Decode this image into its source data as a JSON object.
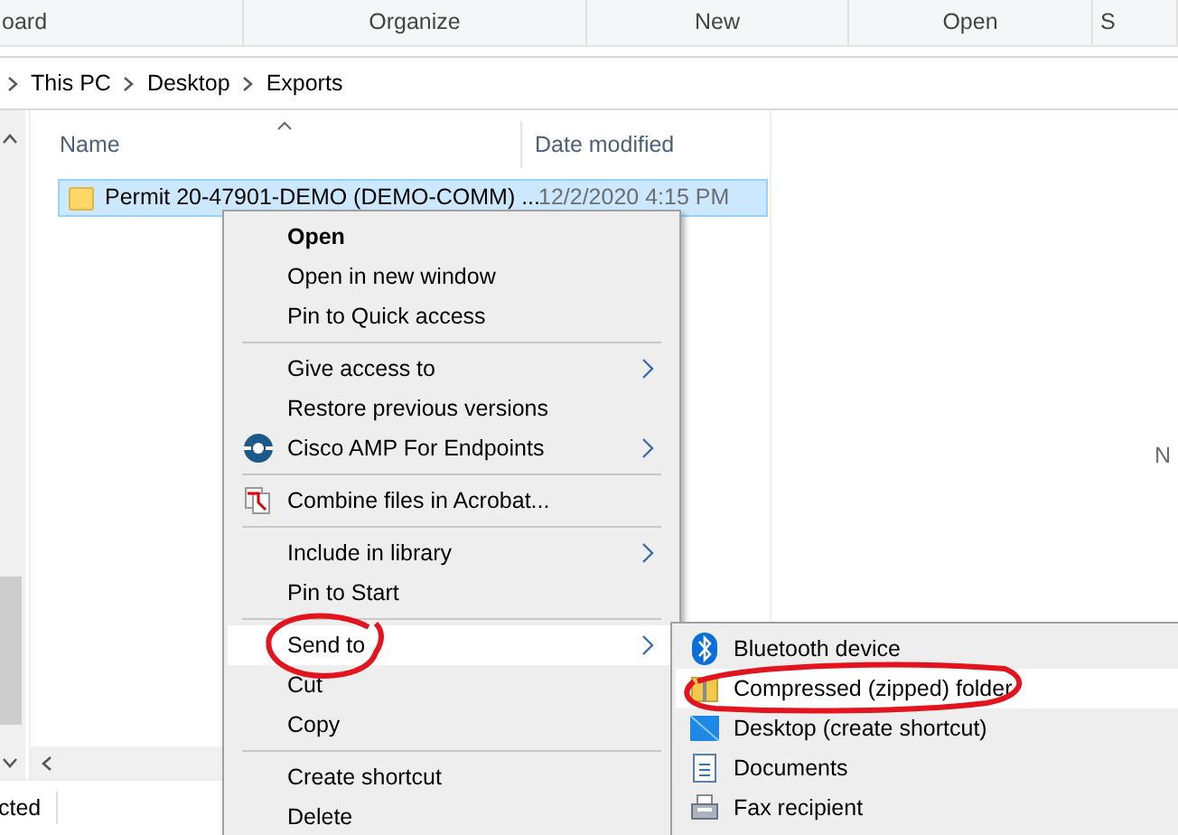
{
  "ribbon": {
    "groups": [
      "oard",
      "Organize",
      "New",
      "Open",
      "S"
    ]
  },
  "breadcrumb": [
    "This PC",
    "Desktop",
    "Exports"
  ],
  "file_list": {
    "columns": [
      "Name",
      "Date modified"
    ],
    "rows": [
      {
        "name": "Permit 20-47901-DEMO (DEMO-COMM) ...",
        "date": "12/2/2020 4:15 PM",
        "selected": true
      }
    ]
  },
  "details_pane": {
    "text": "N"
  },
  "status_bar": {
    "text": "cted"
  },
  "context_menu": {
    "items": [
      {
        "kind": "item",
        "label": "Open",
        "default": true,
        "submenu": false,
        "selected": false
      },
      {
        "kind": "item",
        "label": "Open in new window",
        "default": false,
        "submenu": false,
        "selected": false
      },
      {
        "kind": "item",
        "label": "Pin to Quick access",
        "default": false,
        "submenu": false,
        "selected": false
      },
      {
        "kind": "separator"
      },
      {
        "kind": "item",
        "label": "Give access to",
        "default": false,
        "submenu": true,
        "selected": false
      },
      {
        "kind": "item",
        "label": "Restore previous versions",
        "default": false,
        "submenu": false,
        "selected": false
      },
      {
        "kind": "item",
        "label": "Cisco AMP For Endpoints",
        "default": false,
        "submenu": true,
        "selected": false
      },
      {
        "kind": "separator"
      },
      {
        "kind": "item",
        "label": "Combine files in Acrobat...",
        "default": false,
        "submenu": false,
        "selected": false
      },
      {
        "kind": "separator"
      },
      {
        "kind": "item",
        "label": "Include in library",
        "default": false,
        "submenu": true,
        "selected": false
      },
      {
        "kind": "item",
        "label": "Pin to Start",
        "default": false,
        "submenu": false,
        "selected": false
      },
      {
        "kind": "separator"
      },
      {
        "kind": "item",
        "label": "Send to",
        "default": false,
        "submenu": true,
        "selected": true
      },
      {
        "kind": "item",
        "label": "Cut",
        "default": false,
        "submenu": false,
        "selected": false
      },
      {
        "kind": "item",
        "label": "Copy",
        "default": false,
        "submenu": false,
        "selected": false
      },
      {
        "kind": "separator"
      },
      {
        "kind": "item",
        "label": "Create shortcut",
        "default": false,
        "submenu": false,
        "selected": false
      },
      {
        "kind": "item",
        "label": "Delete",
        "default": false,
        "submenu": false,
        "selected": false
      }
    ]
  },
  "send_to_menu": {
    "items": [
      {
        "label": "Bluetooth device",
        "selected": false
      },
      {
        "label": "Compressed (zipped) folder",
        "selected": true
      },
      {
        "label": "Desktop (create shortcut)",
        "selected": false
      },
      {
        "label": "Documents",
        "selected": false
      },
      {
        "label": "Fax recipient",
        "selected": false
      }
    ]
  }
}
